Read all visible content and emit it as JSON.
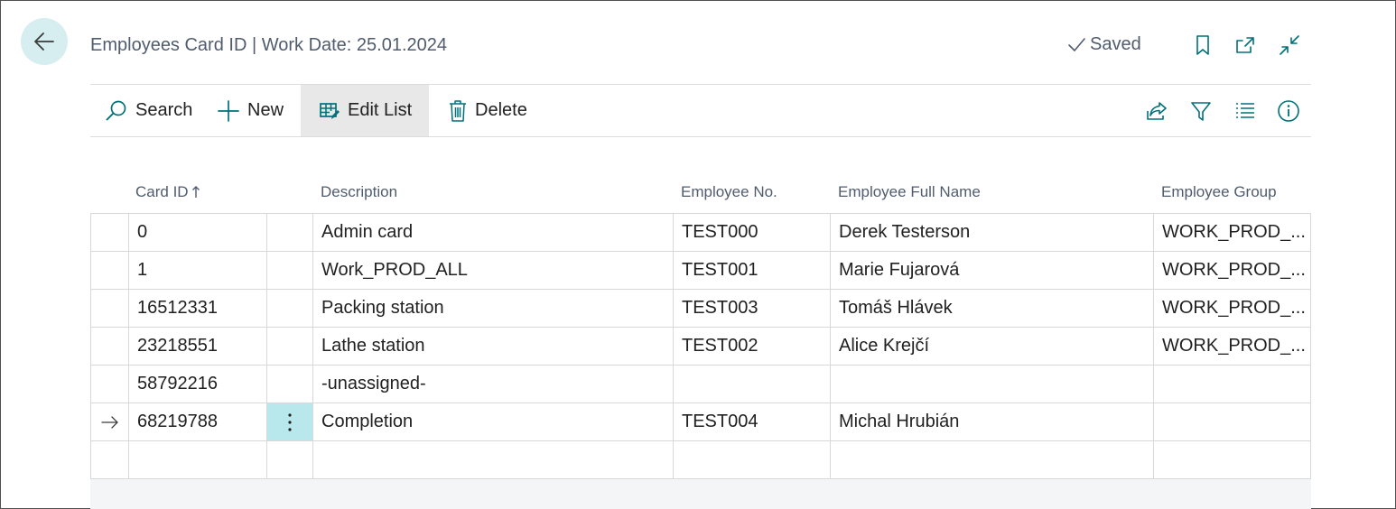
{
  "header": {
    "title": "Employees Card ID | Work Date: 25.01.2024",
    "saved_label": "Saved"
  },
  "toolbar": {
    "search_label": "Search",
    "new_label": "New",
    "edit_list_label": "Edit List",
    "delete_label": "Delete"
  },
  "columns": {
    "card_id": "Card ID",
    "description": "Description",
    "employee_no": "Employee No.",
    "employee_full_name": "Employee Full Name",
    "employee_group": "Employee Group"
  },
  "rows": [
    {
      "card_id": "0",
      "description": "Admin card",
      "employee_no": "TEST000",
      "employee_full_name": "Derek Testerson",
      "employee_group": "WORK_PROD_..."
    },
    {
      "card_id": "1",
      "description": "Work_PROD_ALL",
      "employee_no": "TEST001",
      "employee_full_name": "Marie Fujarová",
      "employee_group": "WORK_PROD_..."
    },
    {
      "card_id": "16512331",
      "description": "Packing station",
      "employee_no": "TEST003",
      "employee_full_name": "Tomáš Hlávek",
      "employee_group": "WORK_PROD_..."
    },
    {
      "card_id": "23218551",
      "description": "Lathe station",
      "employee_no": "TEST002",
      "employee_full_name": "Alice Krejčí",
      "employee_group": "WORK_PROD_..."
    },
    {
      "card_id": "58792216",
      "description": "-unassigned-",
      "employee_no": "",
      "employee_full_name": "",
      "employee_group": ""
    },
    {
      "card_id": "68219788",
      "description": "Completion",
      "employee_no": "TEST004",
      "employee_full_name": "Michal Hrubián",
      "employee_group": ""
    }
  ],
  "colors": {
    "accent": "#00707a",
    "selected_cell": "#b8e7ec",
    "back_button_bg": "#d6eef0"
  },
  "icons": {
    "back": "arrow-left-icon",
    "saved": "checkmark-icon",
    "bookmark": "bookmark-icon",
    "open_new": "open-in-new-window-icon",
    "collapse": "collapse-icon",
    "search": "search-icon",
    "new": "plus-icon",
    "edit_list": "edit-list-icon",
    "delete": "trash-icon",
    "share": "share-icon",
    "filter": "filter-icon",
    "list_view": "list-view-icon",
    "info": "info-icon",
    "sort": "sort-ascending-icon",
    "current_row": "arrow-right-icon",
    "row_menu": "more-vertical-icon"
  }
}
